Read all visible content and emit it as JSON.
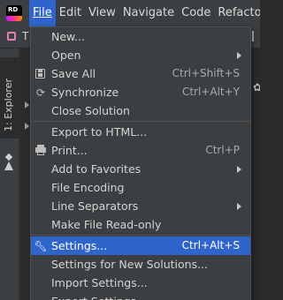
{
  "app": {
    "icon_text": "RD"
  },
  "menubar": {
    "items": [
      {
        "label": "File",
        "active": true
      },
      {
        "label": "Edit"
      },
      {
        "label": "View"
      },
      {
        "label": "Navigate"
      },
      {
        "label": "Code"
      },
      {
        "label": "Refactor"
      }
    ]
  },
  "toolbar": {
    "partial_label": "T"
  },
  "sidebar": {
    "explorer_tab_label": "1: Explorer"
  },
  "file_menu": {
    "items": [
      {
        "label": "New...",
        "has_submenu": true
      },
      {
        "label": "Open",
        "has_submenu": true
      },
      {
        "label": "Save All",
        "shortcut": "Ctrl+Shift+S",
        "icon": "save-icon"
      },
      {
        "label": "Synchronize",
        "shortcut": "Ctrl+Alt+Y",
        "icon": "sync-icon"
      },
      {
        "label": "Close Solution"
      },
      {
        "label": "Export to HTML..."
      },
      {
        "label": "Print...",
        "shortcut": "Ctrl+P",
        "icon": "print-icon"
      },
      {
        "label": "Add to Favorites",
        "has_submenu": true
      },
      {
        "label": "File Encoding"
      },
      {
        "label": "Line Separators",
        "has_submenu": true
      },
      {
        "label": "Make File Read-only"
      },
      {
        "label": "Settings...",
        "shortcut": "Ctrl+Alt+S",
        "icon": "wrench-icon",
        "selected": true
      },
      {
        "label": "Settings for New Solutions..."
      },
      {
        "label": "Import Settings..."
      },
      {
        "label": "Export Settings..."
      }
    ]
  },
  "colors": {
    "menu_bg": "#3c3f41",
    "selection": "#2f65ca",
    "editor_bg": "#2b2b2b",
    "text": "#d4d4d4",
    "shortcut_text": "#a9a9a9"
  }
}
